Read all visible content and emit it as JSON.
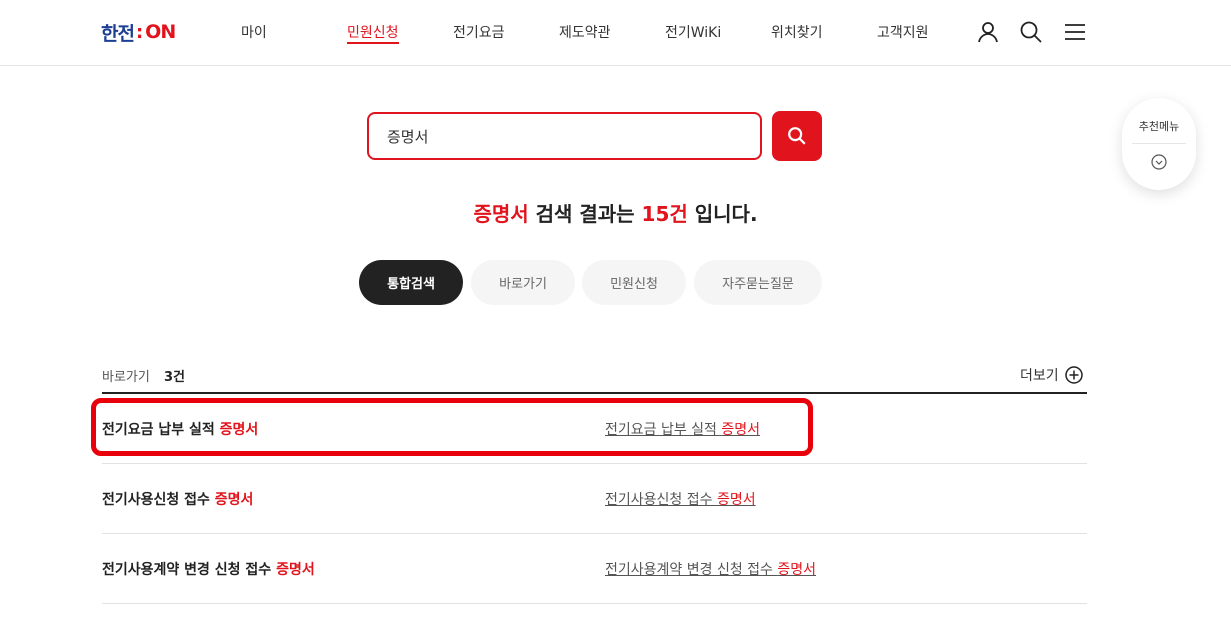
{
  "header": {
    "logo": {
      "part1": "한전",
      "colon": ":",
      "part2": "ON"
    },
    "nav": [
      {
        "label": "마이"
      },
      {
        "label": "민원신청"
      },
      {
        "label": "전기요금"
      },
      {
        "label": "제도약관"
      },
      {
        "label": "전기WiKi"
      },
      {
        "label": "위치찾기"
      },
      {
        "label": "고객지원"
      }
    ],
    "active_nav": "민원신청"
  },
  "search": {
    "value": "증명서"
  },
  "result": {
    "keyword": "증명서",
    "mid": " 검색 결과는 ",
    "count": "15건",
    "end": " 입니다."
  },
  "tabs": [
    {
      "label": "통합검색",
      "active": true
    },
    {
      "label": "바로가기",
      "active": false
    },
    {
      "label": "민원신청",
      "active": false
    },
    {
      "label": "자주묻는질문",
      "active": false
    }
  ],
  "recommend": {
    "label": "추천메뉴"
  },
  "section": {
    "title": "바로가기",
    "count": "3건",
    "more": "더보기",
    "rows": [
      {
        "title": "전기요금 납부 실적 ",
        "title_hl": "증명서",
        "link": "전기요금 납부 실적 ",
        "link_hl": "증명서"
      },
      {
        "title": "전기사용신청 접수 ",
        "title_hl": "증명서",
        "link": "전기사용신청 접수 ",
        "link_hl": "증명서"
      },
      {
        "title": "전기사용계약 변경 신청 접수 ",
        "title_hl": "증명서",
        "link": "전기사용계약 변경 신청 접수 ",
        "link_hl": "증명서"
      }
    ]
  },
  "colors": {
    "brand_red": "#e1141d",
    "brand_blue": "#1c3f94",
    "dark": "#222222"
  }
}
